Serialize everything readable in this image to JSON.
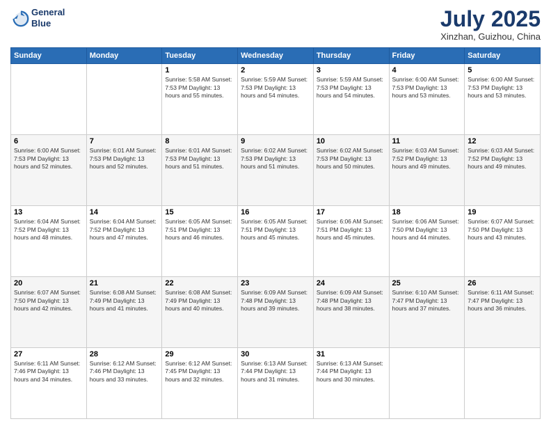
{
  "header": {
    "logo_line1": "General",
    "logo_line2": "Blue",
    "month": "July 2025",
    "location": "Xinzhan, Guizhou, China"
  },
  "weekdays": [
    "Sunday",
    "Monday",
    "Tuesday",
    "Wednesday",
    "Thursday",
    "Friday",
    "Saturday"
  ],
  "weeks": [
    [
      {
        "day": "",
        "detail": ""
      },
      {
        "day": "",
        "detail": ""
      },
      {
        "day": "1",
        "detail": "Sunrise: 5:58 AM\nSunset: 7:53 PM\nDaylight: 13 hours\nand 55 minutes."
      },
      {
        "day": "2",
        "detail": "Sunrise: 5:59 AM\nSunset: 7:53 PM\nDaylight: 13 hours\nand 54 minutes."
      },
      {
        "day": "3",
        "detail": "Sunrise: 5:59 AM\nSunset: 7:53 PM\nDaylight: 13 hours\nand 54 minutes."
      },
      {
        "day": "4",
        "detail": "Sunrise: 6:00 AM\nSunset: 7:53 PM\nDaylight: 13 hours\nand 53 minutes."
      },
      {
        "day": "5",
        "detail": "Sunrise: 6:00 AM\nSunset: 7:53 PM\nDaylight: 13 hours\nand 53 minutes."
      }
    ],
    [
      {
        "day": "6",
        "detail": "Sunrise: 6:00 AM\nSunset: 7:53 PM\nDaylight: 13 hours\nand 52 minutes."
      },
      {
        "day": "7",
        "detail": "Sunrise: 6:01 AM\nSunset: 7:53 PM\nDaylight: 13 hours\nand 52 minutes."
      },
      {
        "day": "8",
        "detail": "Sunrise: 6:01 AM\nSunset: 7:53 PM\nDaylight: 13 hours\nand 51 minutes."
      },
      {
        "day": "9",
        "detail": "Sunrise: 6:02 AM\nSunset: 7:53 PM\nDaylight: 13 hours\nand 51 minutes."
      },
      {
        "day": "10",
        "detail": "Sunrise: 6:02 AM\nSunset: 7:53 PM\nDaylight: 13 hours\nand 50 minutes."
      },
      {
        "day": "11",
        "detail": "Sunrise: 6:03 AM\nSunset: 7:52 PM\nDaylight: 13 hours\nand 49 minutes."
      },
      {
        "day": "12",
        "detail": "Sunrise: 6:03 AM\nSunset: 7:52 PM\nDaylight: 13 hours\nand 49 minutes."
      }
    ],
    [
      {
        "day": "13",
        "detail": "Sunrise: 6:04 AM\nSunset: 7:52 PM\nDaylight: 13 hours\nand 48 minutes."
      },
      {
        "day": "14",
        "detail": "Sunrise: 6:04 AM\nSunset: 7:52 PM\nDaylight: 13 hours\nand 47 minutes."
      },
      {
        "day": "15",
        "detail": "Sunrise: 6:05 AM\nSunset: 7:51 PM\nDaylight: 13 hours\nand 46 minutes."
      },
      {
        "day": "16",
        "detail": "Sunrise: 6:05 AM\nSunset: 7:51 PM\nDaylight: 13 hours\nand 45 minutes."
      },
      {
        "day": "17",
        "detail": "Sunrise: 6:06 AM\nSunset: 7:51 PM\nDaylight: 13 hours\nand 45 minutes."
      },
      {
        "day": "18",
        "detail": "Sunrise: 6:06 AM\nSunset: 7:50 PM\nDaylight: 13 hours\nand 44 minutes."
      },
      {
        "day": "19",
        "detail": "Sunrise: 6:07 AM\nSunset: 7:50 PM\nDaylight: 13 hours\nand 43 minutes."
      }
    ],
    [
      {
        "day": "20",
        "detail": "Sunrise: 6:07 AM\nSunset: 7:50 PM\nDaylight: 13 hours\nand 42 minutes."
      },
      {
        "day": "21",
        "detail": "Sunrise: 6:08 AM\nSunset: 7:49 PM\nDaylight: 13 hours\nand 41 minutes."
      },
      {
        "day": "22",
        "detail": "Sunrise: 6:08 AM\nSunset: 7:49 PM\nDaylight: 13 hours\nand 40 minutes."
      },
      {
        "day": "23",
        "detail": "Sunrise: 6:09 AM\nSunset: 7:48 PM\nDaylight: 13 hours\nand 39 minutes."
      },
      {
        "day": "24",
        "detail": "Sunrise: 6:09 AM\nSunset: 7:48 PM\nDaylight: 13 hours\nand 38 minutes."
      },
      {
        "day": "25",
        "detail": "Sunrise: 6:10 AM\nSunset: 7:47 PM\nDaylight: 13 hours\nand 37 minutes."
      },
      {
        "day": "26",
        "detail": "Sunrise: 6:11 AM\nSunset: 7:47 PM\nDaylight: 13 hours\nand 36 minutes."
      }
    ],
    [
      {
        "day": "27",
        "detail": "Sunrise: 6:11 AM\nSunset: 7:46 PM\nDaylight: 13 hours\nand 34 minutes."
      },
      {
        "day": "28",
        "detail": "Sunrise: 6:12 AM\nSunset: 7:46 PM\nDaylight: 13 hours\nand 33 minutes."
      },
      {
        "day": "29",
        "detail": "Sunrise: 6:12 AM\nSunset: 7:45 PM\nDaylight: 13 hours\nand 32 minutes."
      },
      {
        "day": "30",
        "detail": "Sunrise: 6:13 AM\nSunset: 7:44 PM\nDaylight: 13 hours\nand 31 minutes."
      },
      {
        "day": "31",
        "detail": "Sunrise: 6:13 AM\nSunset: 7:44 PM\nDaylight: 13 hours\nand 30 minutes."
      },
      {
        "day": "",
        "detail": ""
      },
      {
        "day": "",
        "detail": ""
      }
    ]
  ]
}
